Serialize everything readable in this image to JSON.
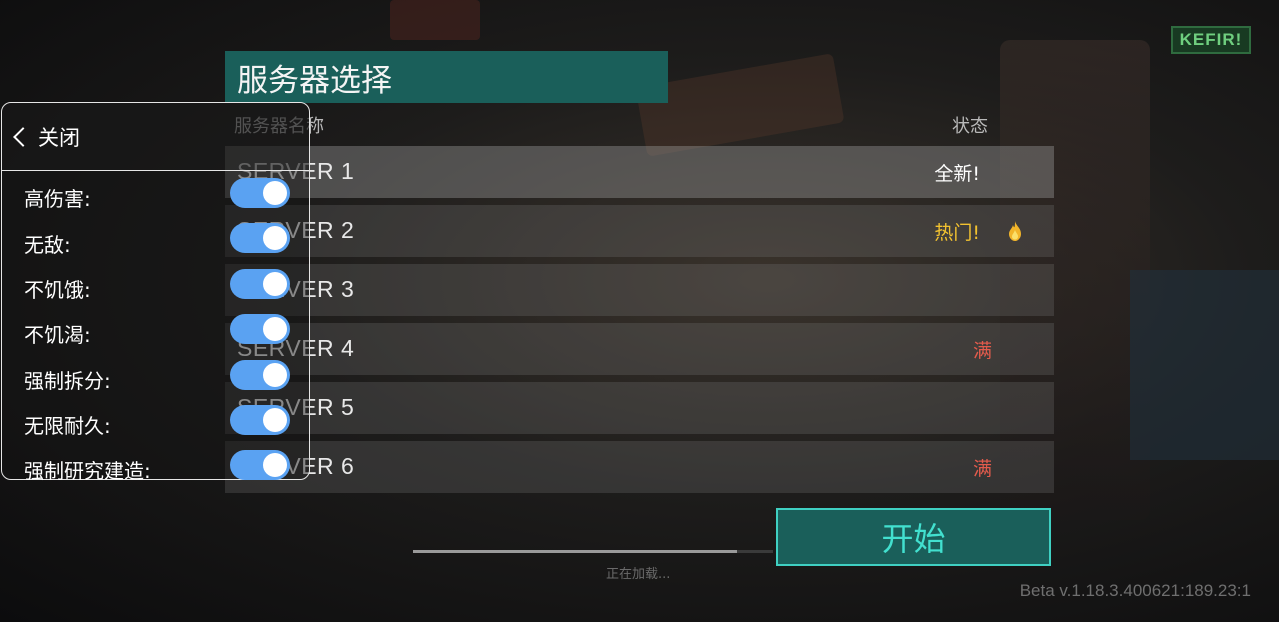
{
  "logo": "KEFIR!",
  "title": "服务器选择",
  "columns": {
    "name": "服务器名称",
    "status": "状态"
  },
  "servers": [
    {
      "name": "SERVER 1",
      "status": "全新!",
      "status_type": "new"
    },
    {
      "name": "SERVER 2",
      "status": "热门!",
      "status_type": "hot",
      "icon": "fire-icon"
    },
    {
      "name": "SERVER 3",
      "status": "",
      "status_type": "none"
    },
    {
      "name": "SERVER 4",
      "status": "满",
      "status_type": "full"
    },
    {
      "name": "SERVER 5",
      "status": "",
      "status_type": "none"
    },
    {
      "name": "SERVER 6",
      "status": "满",
      "status_type": "full"
    }
  ],
  "start_button": "开始",
  "loading": {
    "text": "正在加载...",
    "progress": 0.9
  },
  "version": "Beta v.1.18.3.400621:189.23:1",
  "mod_menu": {
    "close_label": "关闭",
    "items": [
      {
        "label": "高伤害:",
        "enabled": true
      },
      {
        "label": "无敌:",
        "enabled": true
      },
      {
        "label": "不饥饿:",
        "enabled": true
      },
      {
        "label": "不饥渴:",
        "enabled": true
      },
      {
        "label": "强制拆分:",
        "enabled": true
      },
      {
        "label": "无限耐久:",
        "enabled": true
      },
      {
        "label": "强制研究建造:",
        "enabled": true
      }
    ]
  },
  "colors": {
    "accent": "#1a5f5a",
    "accent_text": "#42e0cf",
    "hot": "#f2c230",
    "full": "#e25b4c",
    "toggle": "#5aa2f2"
  }
}
